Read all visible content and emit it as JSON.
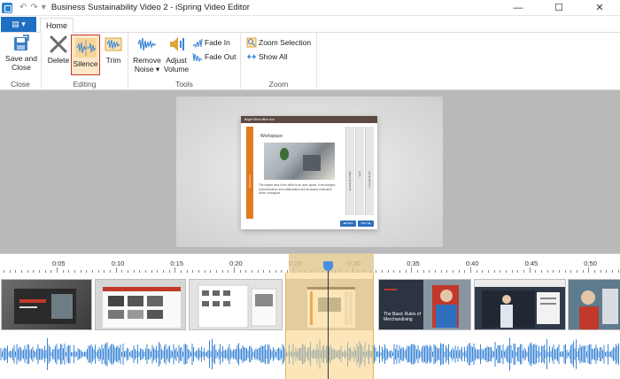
{
  "window": {
    "title": "Business Sustainability Video 2 - iSpring Video Editor",
    "minimize": "—",
    "maximize": "☐",
    "close": "✕"
  },
  "quick_access": {
    "undo": "↶",
    "redo": "↷",
    "customize": "▾"
  },
  "file_menu": {
    "label": "▤ ▾"
  },
  "tabs": {
    "home": "Home"
  },
  "ribbon": {
    "close_group": {
      "label": "Close",
      "save_close_line1": "Save and",
      "save_close_line2": "Close"
    },
    "editing_group": {
      "label": "Editing",
      "delete": "Delete",
      "silence": "Silence",
      "trim": "Trim"
    },
    "tools_group": {
      "label": "Tools",
      "remove_noise_line1": "Remove",
      "remove_noise_line2": "Noise ▾",
      "adjust_volume_line1": "Adjust",
      "adjust_volume_line2": "Volume",
      "fade_in": "Fade In",
      "fade_out": "Fade Out"
    },
    "zoom_group": {
      "label": "Zoom",
      "zoom_selection": "Zoom Selection",
      "show_all": "Show All"
    }
  },
  "slide": {
    "header": "Bright Mind office tour",
    "side_label": "Workspace",
    "title": "Workspace",
    "body": "The largest area in the office is an open space. It encourages communication and collaboration and increases motivation within colleagues.",
    "tab1": "Awards & Coffee",
    "tab2": "Gym",
    "tab3": "Lounge Room",
    "prev": "◀ PREV",
    "next": "NEXT ▶"
  },
  "timeline": {
    "ticks": [
      "0:05",
      "0:10",
      "0:15",
      "0:20",
      "0:25",
      "0:30",
      "0:35",
      "0:40",
      "0:45",
      "0:50"
    ],
    "frames": [
      {
        "caption": ""
      },
      {
        "caption": ""
      },
      {
        "caption": ""
      },
      {
        "caption": ""
      },
      {
        "caption": "The Basic Rules of Merchandising"
      },
      {
        "caption": ""
      },
      {
        "caption": ""
      }
    ]
  },
  "colors": {
    "accent": "#1e6fc2",
    "selection": "#f7d080",
    "waveform": "#3b86d6",
    "highlight_box": "#c0392b"
  }
}
